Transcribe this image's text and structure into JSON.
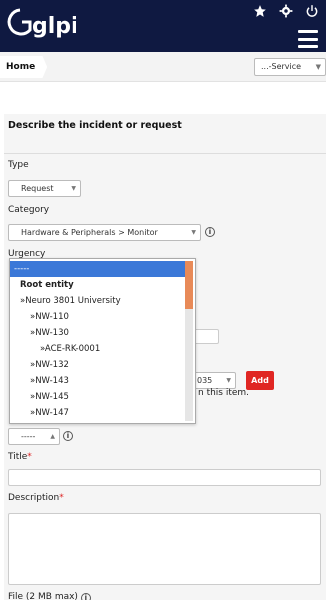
{
  "header": {
    "logo_text": "glpi",
    "icons": [
      "star-icon",
      "gear-icon",
      "power-icon",
      "hamburger-menu-icon"
    ],
    "colors": {
      "bar": "#0f1941",
      "accent": "#e02623"
    }
  },
  "breadcrumb": {
    "home": "Home"
  },
  "service_select": {
    "value": "...-Service"
  },
  "form": {
    "heading": "Describe the incident or request",
    "type_label": "Type",
    "type_value": "Request",
    "category_label": "Category",
    "category_value": "Hardware & Peripherals > Monitor",
    "urgency_label": "Urgency",
    "item_partial_value": "035",
    "add_button": "Add",
    "item_partial_text": "n this item.",
    "dash_value": "-----",
    "title_label": "Title",
    "description_label": "Description",
    "file_label": "File (2 MB max)"
  },
  "dropdown": {
    "items": [
      {
        "label": "-----",
        "highlighted": true
      },
      {
        "label": "Root entity",
        "bold": true
      },
      {
        "label": "»Neuro 3801 University"
      },
      {
        "label": "»NW-110"
      },
      {
        "label": "»NW-130"
      },
      {
        "label": "»ACE-RK-0001"
      },
      {
        "label": "»NW-132"
      },
      {
        "label": "»NW-143"
      },
      {
        "label": "»NW-145"
      },
      {
        "label": "»NW-147"
      }
    ]
  }
}
